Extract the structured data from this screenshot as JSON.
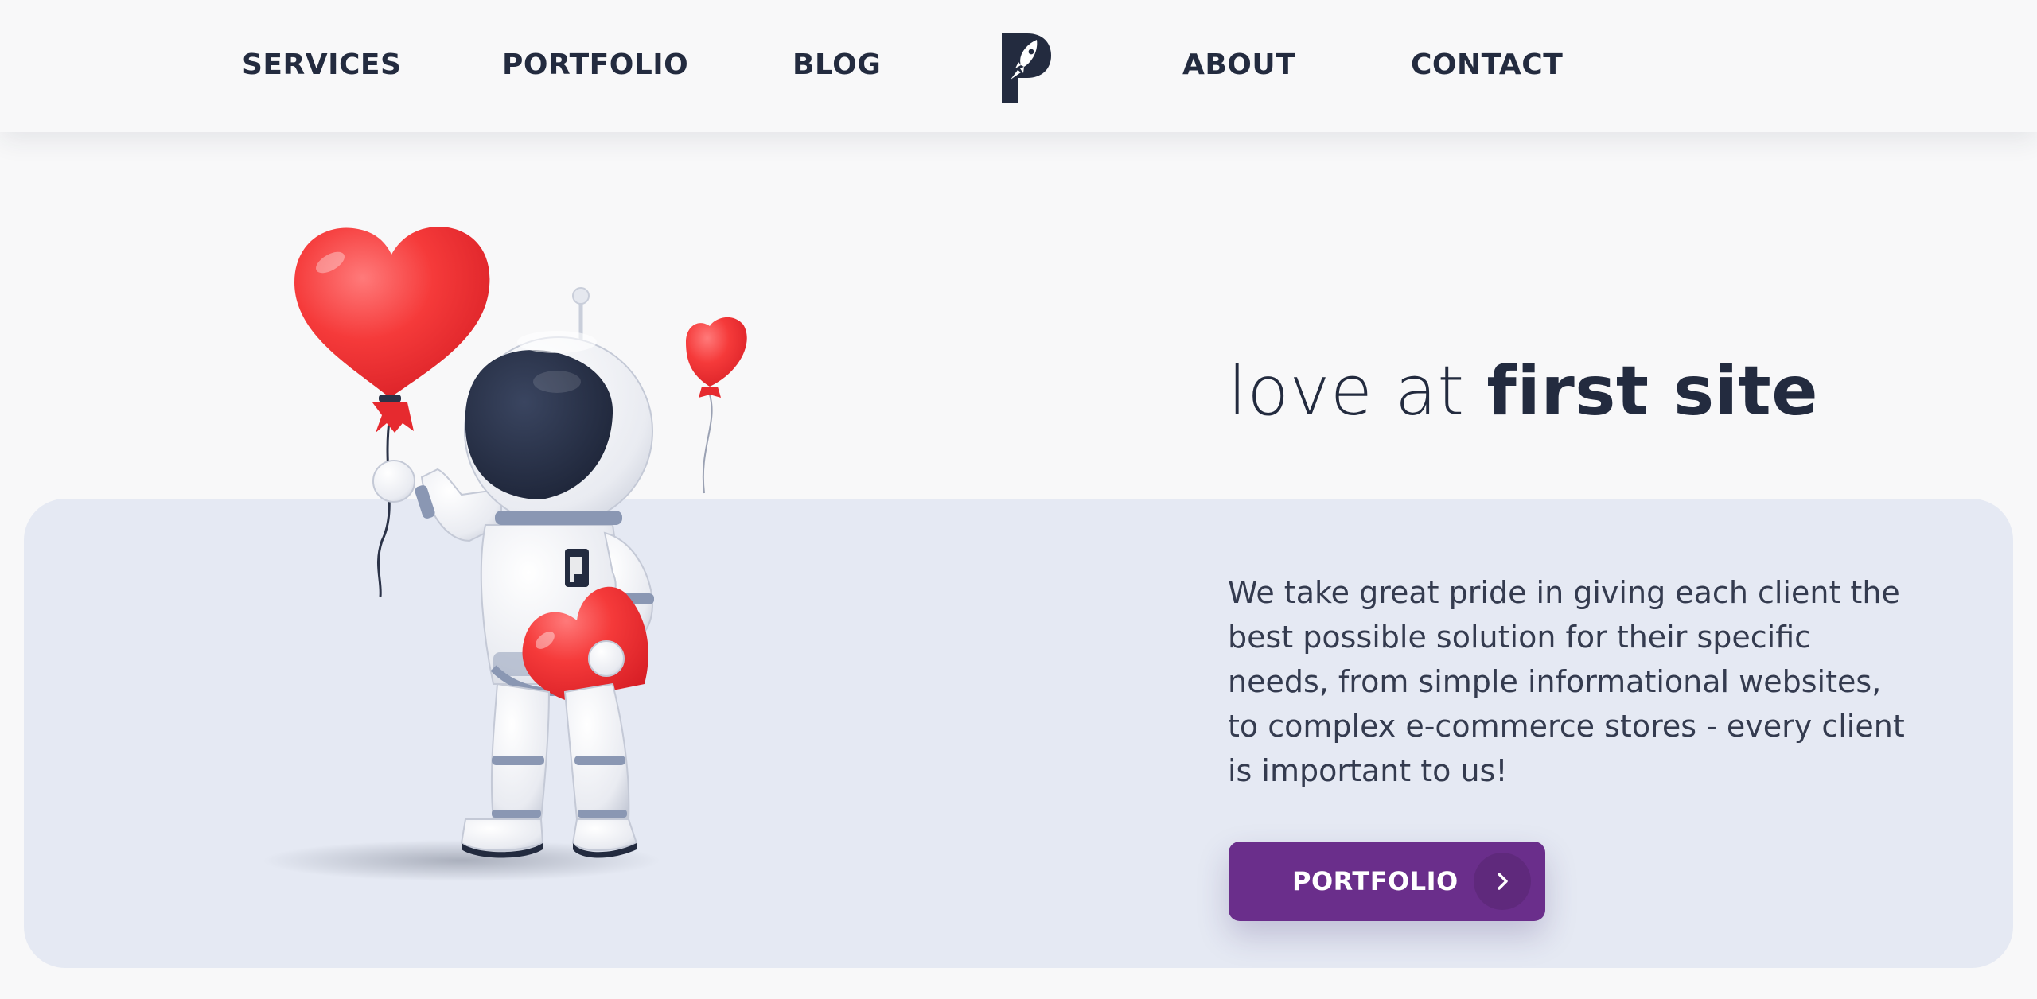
{
  "nav": {
    "services": "SERVICES",
    "portfolio": "PORTFOLIO",
    "blog": "BLOG",
    "about": "ABOUT",
    "contact": "CONTACT"
  },
  "logo": {
    "icon": "rocket-p-logo-icon"
  },
  "hero": {
    "headline_light": "love at ",
    "headline_bold": "first site",
    "description": "We take great pride in giving each client the best possible solution for their specific needs, from simple informational websites, to complex e-commerce stores - every client is important to us!",
    "cta_label": "PORTFOLIO",
    "cta_icon": "chevron-right-icon"
  },
  "colors": {
    "text_dark": "#232b3f",
    "background": "#f8f8f9",
    "band": "#e5e9f3",
    "accent_purple": "#6a2e8b",
    "balloon_red": "#f23b3b"
  }
}
